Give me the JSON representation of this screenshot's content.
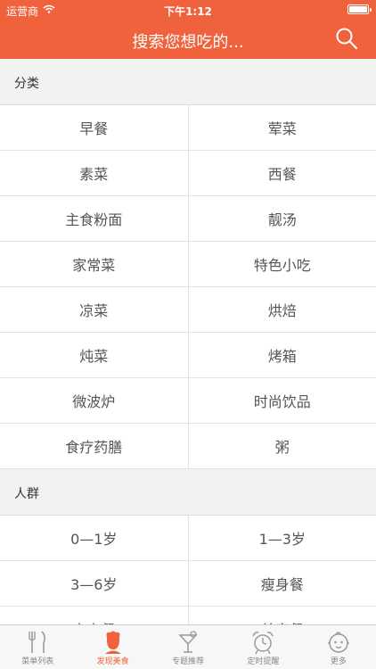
{
  "status": {
    "carrier": "运营商",
    "time": "下午1:12"
  },
  "header": {
    "search_text": "搜索您想吃的...",
    "color": "#f0623c"
  },
  "sections": [
    {
      "title": "分类",
      "rows": [
        [
          "早餐",
          "荤菜"
        ],
        [
          "素菜",
          "西餐"
        ],
        [
          "主食粉面",
          "靓汤"
        ],
        [
          "家常菜",
          "特色小吃"
        ],
        [
          "凉菜",
          "烘焙"
        ],
        [
          "炖菜",
          "烤箱"
        ],
        [
          "微波炉",
          "时尚饮品"
        ],
        [
          "食疗药膳",
          "粥"
        ]
      ]
    },
    {
      "title": "人群",
      "rows": [
        [
          "0—1岁",
          "1—3岁"
        ],
        [
          "3—6岁",
          "瘦身餐"
        ],
        [
          "宝宝餐",
          "美容餐"
        ]
      ]
    }
  ],
  "tabbar": {
    "active_index": 1,
    "items": [
      {
        "label": "菜单列表",
        "icon": "fork-knife-icon"
      },
      {
        "label": "发现美食",
        "icon": "chef-icon"
      },
      {
        "label": "专题推荐",
        "icon": "cocktail-icon"
      },
      {
        "label": "定时提醒",
        "icon": "alarm-clock-icon"
      },
      {
        "label": "更多",
        "icon": "baby-face-icon"
      }
    ]
  }
}
